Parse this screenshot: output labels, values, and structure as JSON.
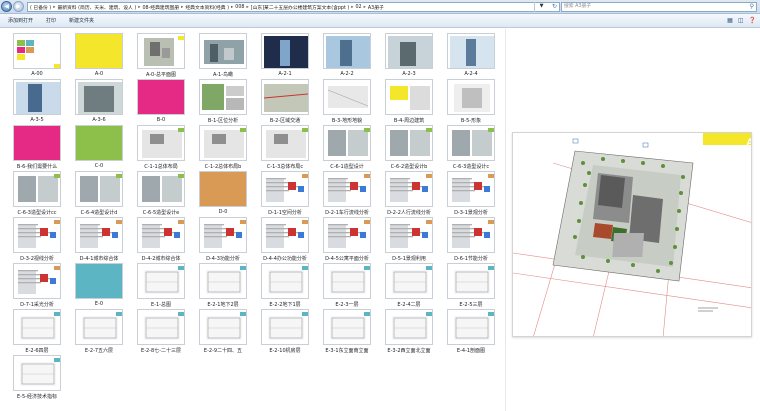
{
  "window": {
    "breadcrumb": [
      "( 已备份 )",
      "最新资料 (简历、天米、建筑、设人 )",
      "08-经典建筑图册",
      "经典文本资料(经典 )",
      "008",
      "[山东]某二十五层办公楼建筑方案文本(含ppt )",
      "02",
      "A3册子"
    ],
    "search_placeholder": "搜索 A3册子"
  },
  "toolbar": {
    "items": [
      "添加到打开",
      "打印",
      "新建文件夹"
    ]
  },
  "accent_colors": {
    "yellow": "#f4e62b",
    "magenta": "#e42a85",
    "green": "#8cc04a",
    "orange": "#d99a55",
    "teal": "#5bb5c2"
  },
  "files": [
    "A-00",
    "A-0",
    "A-0-总平面图",
    "A-1-鸟瞰",
    "A-2-1",
    "A-2-2",
    "A-2-3",
    "A-2-4",
    "A-3-5",
    "A-3-6",
    "B-0",
    "B-1-区位分析",
    "B-2-区域交通",
    "B-3-地形地貌",
    "B-4-周边建筑",
    "B-5-形象",
    "B-6-我们需要什么",
    "C-0",
    "C-1-1总体布局",
    "C-1-2总体布局b",
    "C-1-3总体布局c",
    "C-6-1造型设计",
    "C-6-2造型设计b",
    "C-6-3造型设计c",
    "C-6-3造型设计cc",
    "C-6-4造型设计d",
    "C-6-5造型设计e",
    "D-0",
    "D-1-1空间分析",
    "D-2-1车行流线分析",
    "D-2-2人行流线分析",
    "D-3-1景观分析",
    "D-3-2视线分析",
    "D-4-1城市综合体",
    "D-4-2城市综合体",
    "D-4-3功能分析",
    "D-4-4办公功能分析",
    "D-4-5公寓平面分析",
    "D-5-1景观利用",
    "D-6-1节能分析",
    "D-7-1采光分析",
    "E-0",
    "E-1-总图",
    "E-2-1地下2层",
    "E-2-2地下1层",
    "E-2-3一层",
    "E-2-4二层",
    "E-2-5三层",
    "E-2-6四层",
    "E-2-7五六层",
    "E-2-8七-二十三层",
    "E-2-9二十四、五",
    "E-2-10机房层",
    "E-3-1东立面南立面",
    "E-3-2西立面北立面",
    "E-4-1剖面图",
    "E-5-经济技术指标"
  ],
  "preview": {
    "corner_letter": "A"
  }
}
